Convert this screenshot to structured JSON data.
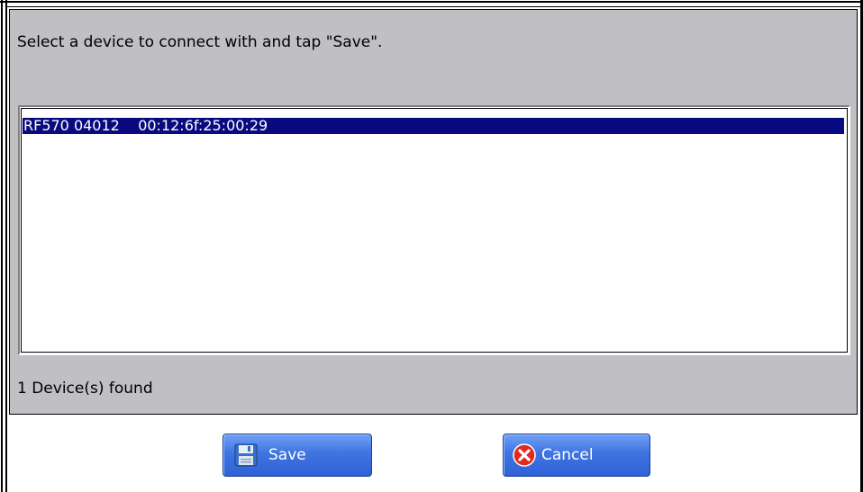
{
  "dialog": {
    "prompt": "Select a device to connect with and tap \"Save\".",
    "devices": [
      {
        "label": "RF570 04012    00:12:6f:25:00:29",
        "selected": true
      }
    ],
    "status": "1 Device(s) found"
  },
  "buttons": {
    "save_label": "Save",
    "save_icon": "floppy-disk-icon",
    "cancel_label": "Cancel",
    "cancel_icon": "red-x-icon"
  },
  "colors": {
    "panel": "#c0bfc3",
    "selection": "#0a0a80",
    "button": "#3f74e1"
  }
}
